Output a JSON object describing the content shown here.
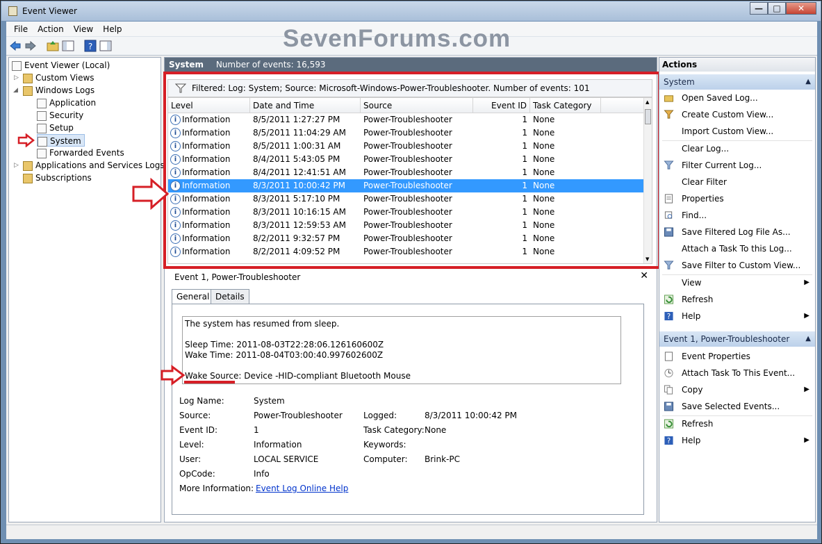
{
  "window": {
    "title": "Event Viewer",
    "buttons": [
      "—",
      "□",
      "✕"
    ]
  },
  "watermark": "SevenForums.com",
  "menu": [
    "File",
    "Action",
    "View",
    "Help"
  ],
  "tree": {
    "root": "Event Viewer (Local)",
    "custom_views": "Custom Views",
    "windows_logs": "Windows Logs",
    "application": "Application",
    "security": "Security",
    "setup": "Setup",
    "system": "System",
    "forwarded": "Forwarded Events",
    "app_services": "Applications and Services Logs",
    "subscriptions": "Subscriptions"
  },
  "center": {
    "log_name": "System",
    "event_count": "Number of events: 16,593",
    "filter_text": "Filtered: Log: System; Source: Microsoft-Windows-Power-Troubleshooter. Number of events: 101",
    "columns": [
      "Level",
      "Date and Time",
      "Source",
      "Event ID",
      "Task Category"
    ],
    "rows": [
      {
        "level": "Information",
        "date": "8/5/2011 1:27:27 PM",
        "source": "Power-Troubleshooter",
        "id": "1",
        "cat": "None"
      },
      {
        "level": "Information",
        "date": "8/5/2011 11:04:29 AM",
        "source": "Power-Troubleshooter",
        "id": "1",
        "cat": "None"
      },
      {
        "level": "Information",
        "date": "8/5/2011 1:00:31 AM",
        "source": "Power-Troubleshooter",
        "id": "1",
        "cat": "None"
      },
      {
        "level": "Information",
        "date": "8/4/2011 5:43:05 PM",
        "source": "Power-Troubleshooter",
        "id": "1",
        "cat": "None"
      },
      {
        "level": "Information",
        "date": "8/4/2011 12:41:51 AM",
        "source": "Power-Troubleshooter",
        "id": "1",
        "cat": "None"
      },
      {
        "level": "Information",
        "date": "8/3/2011 10:00:42 PM",
        "source": "Power-Troubleshooter",
        "id": "1",
        "cat": "None"
      },
      {
        "level": "Information",
        "date": "8/3/2011 5:17:10 PM",
        "source": "Power-Troubleshooter",
        "id": "1",
        "cat": "None"
      },
      {
        "level": "Information",
        "date": "8/3/2011 10:16:15 AM",
        "source": "Power-Troubleshooter",
        "id": "1",
        "cat": "None"
      },
      {
        "level": "Information",
        "date": "8/3/2011 12:59:53 AM",
        "source": "Power-Troubleshooter",
        "id": "1",
        "cat": "None"
      },
      {
        "level": "Information",
        "date": "8/2/2011 9:32:57 PM",
        "source": "Power-Troubleshooter",
        "id": "1",
        "cat": "None"
      },
      {
        "level": "Information",
        "date": "8/2/2011 4:09:52 PM",
        "source": "Power-Troubleshooter",
        "id": "1",
        "cat": "None"
      }
    ],
    "selected_row": 5
  },
  "detail": {
    "title": "Event 1, Power-Troubleshooter",
    "tab_general": "General",
    "tab_details": "Details",
    "msg_line1": "The system has resumed from sleep.",
    "msg_sleep": "Sleep Time: 2011-08-03T22:28:06.126160600Z",
    "msg_wake": "Wake Time: 2011-08-04T03:00:40.997602600Z",
    "msg_source": "Wake Source: Device -HID-compliant Bluetooth Mouse",
    "log_name_lbl": "Log Name:",
    "log_name_val": "System",
    "source_lbl": "Source:",
    "source_val": "Power-Troubleshooter",
    "logged_lbl": "Logged:",
    "logged_val": "8/3/2011 10:00:42 PM",
    "eventid_lbl": "Event ID:",
    "eventid_val": "1",
    "taskcat_lbl": "Task Category:",
    "taskcat_val": "None",
    "level_lbl": "Level:",
    "level_val": "Information",
    "keywords_lbl": "Keywords:",
    "keywords_val": "",
    "user_lbl": "User:",
    "user_val": "LOCAL SERVICE",
    "computer_lbl": "Computer:",
    "computer_val": "Brink-PC",
    "opcode_lbl": "OpCode:",
    "opcode_val": "Info",
    "moreinfo_lbl": "More Information:",
    "moreinfo_link": "Event Log Online Help"
  },
  "actions": {
    "header": "Actions",
    "sec_system": "System",
    "sec_event": "Event 1, Power-Troubleshooter",
    "system_items": [
      "Open Saved Log...",
      "Create Custom View...",
      "Import Custom View...",
      "Clear Log...",
      "Filter Current Log...",
      "Clear Filter",
      "Properties",
      "Find...",
      "Save Filtered Log File As...",
      "Attach a Task To this Log...",
      "Save Filter to Custom View...",
      "View",
      "Refresh",
      "Help"
    ],
    "event_items": [
      "Event Properties",
      "Attach Task To This Event...",
      "Copy",
      "Save Selected Events...",
      "Refresh",
      "Help"
    ]
  },
  "colors": {
    "selection": "#3399ff",
    "annotation": "#d61f26",
    "header": "#5b6b7d"
  }
}
